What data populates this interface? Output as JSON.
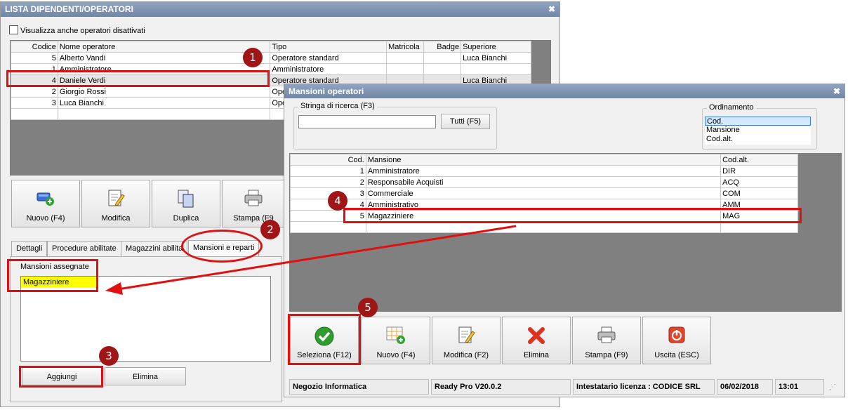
{
  "main_window": {
    "title": "LISTA DIPENDENTI/OPERATORI",
    "show_disabled_label": "Visualizza anche operatori disattivati",
    "columns": [
      "Codice",
      "Nome operatore",
      "Tipo",
      "Matricola",
      "Badge",
      "Superiore"
    ],
    "rows": [
      {
        "code": "5",
        "name": "Alberto Vandi",
        "type": "Operatore standard",
        "matricola": "",
        "badge": "",
        "superior": "Luca Bianchi"
      },
      {
        "code": "1",
        "name": "Amministratore",
        "type": "Amministratore",
        "matricola": "",
        "badge": "",
        "superior": ""
      },
      {
        "code": "4",
        "name": "Daniele Verdi",
        "type": "Operatore standard",
        "matricola": "",
        "badge": "",
        "superior": "Luca Bianchi"
      },
      {
        "code": "2",
        "name": "Giorgio Rossi",
        "type": "Ope",
        "matricola": "",
        "badge": "",
        "superior": ""
      },
      {
        "code": "3",
        "name": "Luca Bianchi",
        "type": "Ope",
        "matricola": "",
        "badge": "",
        "superior": ""
      }
    ],
    "buttons": {
      "new": "Nuovo (F4)",
      "edit": "Modifica",
      "duplicate": "Duplica",
      "print": "Stampa (F9"
    },
    "tabs": [
      "Dettagli",
      "Procedure abilitate",
      "Magazzini abilita",
      "Mansioni e reparti"
    ],
    "assigned_group_label": "Mansioni assegnate",
    "assigned_items": [
      "Magazziniere"
    ],
    "add_button": "Aggiungi",
    "delete_button": "Elimina"
  },
  "dialog": {
    "title": "Mansioni operatori",
    "search_label": "Stringa di ricerca (F3)",
    "search_value": "",
    "all_button": "Tutti (F5)",
    "sort_label": "Ordinamento",
    "sort_options": [
      "Cod.",
      "Mansione",
      "Cod.alt."
    ],
    "sort_selected": "Cod.",
    "columns": [
      "Cod.",
      "Mansione",
      "Cod.alt."
    ],
    "rows": [
      {
        "code": "1",
        "name": "Amministratore",
        "alt": "DIR"
      },
      {
        "code": "2",
        "name": "Responsabile Acquisti",
        "alt": "ACQ"
      },
      {
        "code": "3",
        "name": "Commerciale",
        "alt": "COM"
      },
      {
        "code": "4",
        "name": "Amministrativo",
        "alt": "AMM"
      },
      {
        "code": "5",
        "name": "Magazziniere",
        "alt": "MAG"
      }
    ],
    "buttons": {
      "select": "Seleziona (F12)",
      "new": "Nuovo (F4)",
      "edit": "Modifica (F2)",
      "delete": "Elimina",
      "print": "Stampa (F9)",
      "exit": "Uscita (ESC)"
    },
    "status": {
      "company": "Negozio Informatica",
      "version": "Ready Pro V20.0.2",
      "license": "Intestatario licenza : CODICE SRL",
      "date": "06/02/2018",
      "time": "13:01"
    }
  },
  "callouts": [
    "1",
    "2",
    "3",
    "4",
    "5"
  ],
  "colors": {
    "callout": "#e01010",
    "badge": "#a01515",
    "highlight": "#ffff00",
    "titlebar": "#7b90ae"
  }
}
